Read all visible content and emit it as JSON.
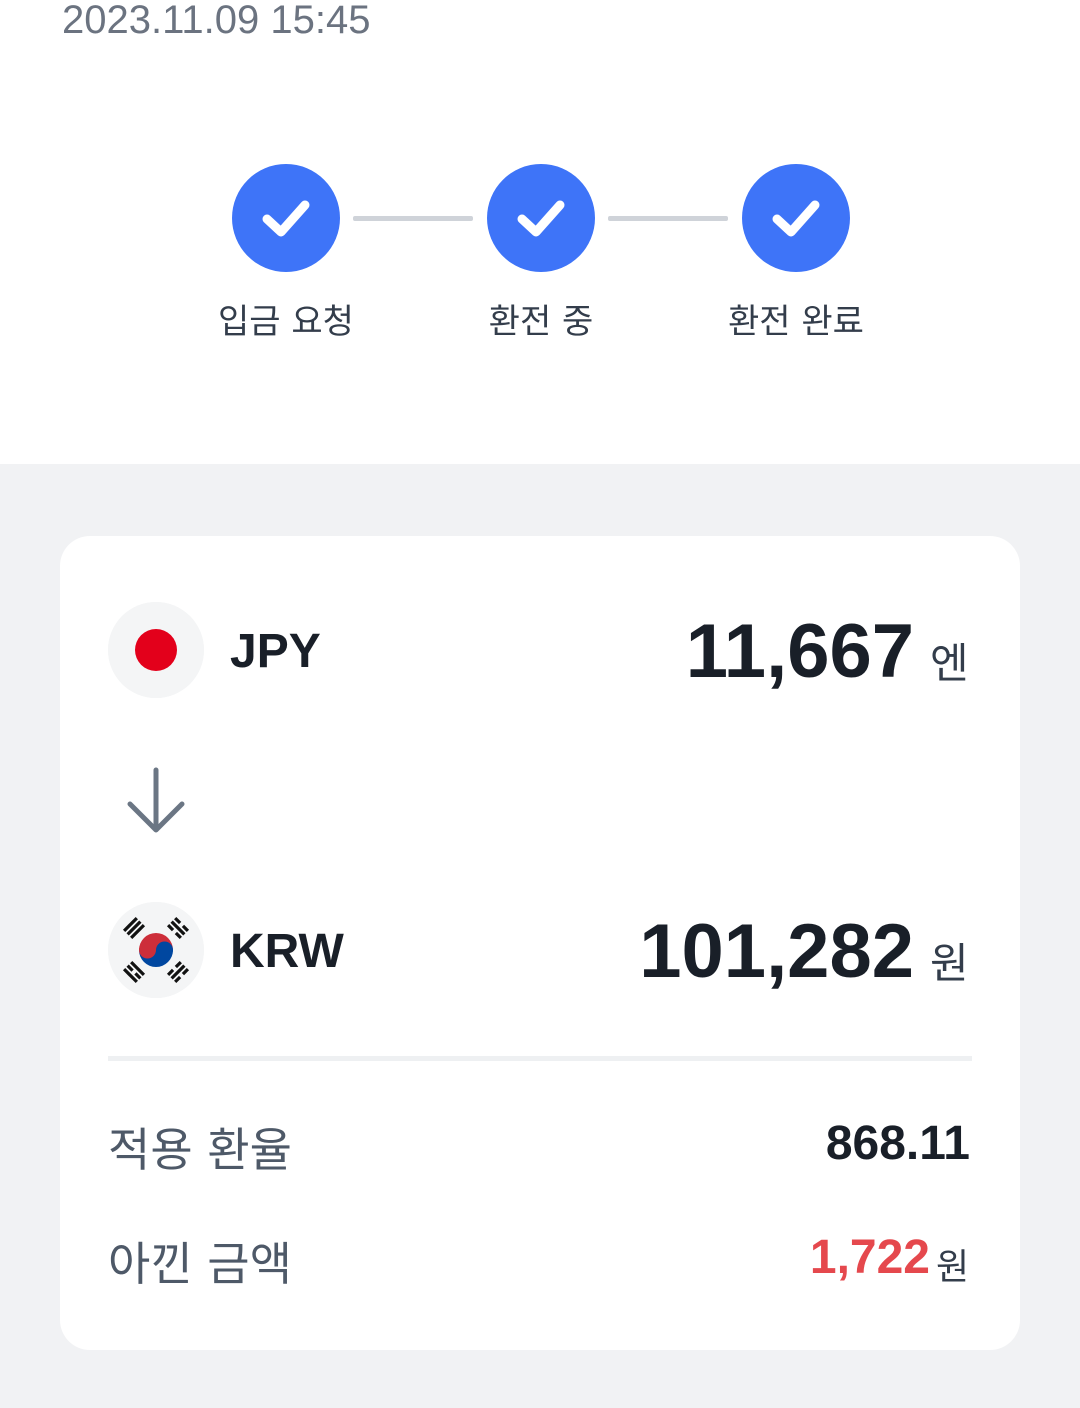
{
  "header": {
    "timestamp": "2023.11.09 15:45"
  },
  "stepper": {
    "accent_color": "#3e74f8",
    "steps": [
      {
        "label": "입금 요청",
        "state": "done",
        "icon": "check-icon"
      },
      {
        "label": "환전 중",
        "state": "done",
        "icon": "check-icon"
      },
      {
        "label": "환전 완료",
        "state": "done",
        "icon": "check-icon"
      }
    ]
  },
  "exchange": {
    "from": {
      "currency": "JPY",
      "flag": "japan-flag-icon",
      "amount": "11,667",
      "unit": "엔"
    },
    "arrow_icon": "arrow-down-icon",
    "to": {
      "currency": "KRW",
      "flag": "korea-flag-icon",
      "amount": "101,282",
      "unit": "원"
    },
    "rate_label": "적용 환율",
    "rate_value": "868.11",
    "saved_label": "아낀 금액",
    "saved_value": "1,722",
    "saved_unit": "원",
    "saved_color": "#e5484d"
  }
}
